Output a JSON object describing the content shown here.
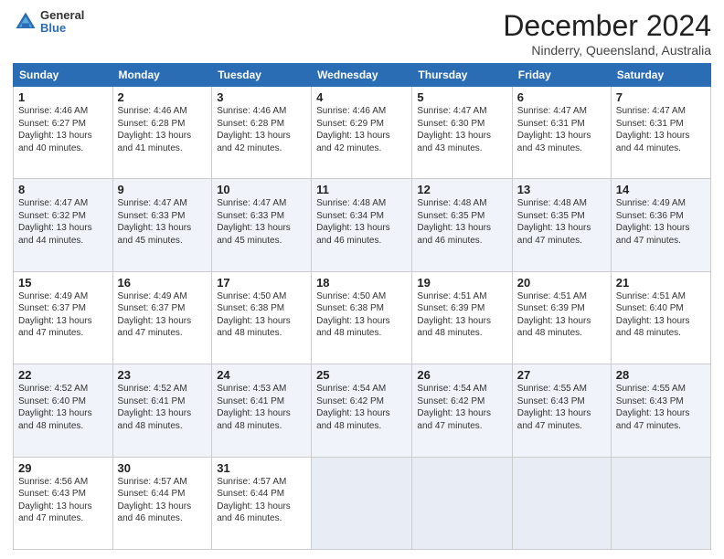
{
  "logo": {
    "general": "General",
    "blue": "Blue"
  },
  "header": {
    "month": "December 2024",
    "location": "Ninderry, Queensland, Australia"
  },
  "columns": [
    "Sunday",
    "Monday",
    "Tuesday",
    "Wednesday",
    "Thursday",
    "Friday",
    "Saturday"
  ],
  "weeks": [
    [
      {
        "day": "1",
        "info": "Sunrise: 4:46 AM\nSunset: 6:27 PM\nDaylight: 13 hours\nand 40 minutes."
      },
      {
        "day": "2",
        "info": "Sunrise: 4:46 AM\nSunset: 6:28 PM\nDaylight: 13 hours\nand 41 minutes."
      },
      {
        "day": "3",
        "info": "Sunrise: 4:46 AM\nSunset: 6:28 PM\nDaylight: 13 hours\nand 42 minutes."
      },
      {
        "day": "4",
        "info": "Sunrise: 4:46 AM\nSunset: 6:29 PM\nDaylight: 13 hours\nand 42 minutes."
      },
      {
        "day": "5",
        "info": "Sunrise: 4:47 AM\nSunset: 6:30 PM\nDaylight: 13 hours\nand 43 minutes."
      },
      {
        "day": "6",
        "info": "Sunrise: 4:47 AM\nSunset: 6:31 PM\nDaylight: 13 hours\nand 43 minutes."
      },
      {
        "day": "7",
        "info": "Sunrise: 4:47 AM\nSunset: 6:31 PM\nDaylight: 13 hours\nand 44 minutes."
      }
    ],
    [
      {
        "day": "8",
        "info": "Sunrise: 4:47 AM\nSunset: 6:32 PM\nDaylight: 13 hours\nand 44 minutes."
      },
      {
        "day": "9",
        "info": "Sunrise: 4:47 AM\nSunset: 6:33 PM\nDaylight: 13 hours\nand 45 minutes."
      },
      {
        "day": "10",
        "info": "Sunrise: 4:47 AM\nSunset: 6:33 PM\nDaylight: 13 hours\nand 45 minutes."
      },
      {
        "day": "11",
        "info": "Sunrise: 4:48 AM\nSunset: 6:34 PM\nDaylight: 13 hours\nand 46 minutes."
      },
      {
        "day": "12",
        "info": "Sunrise: 4:48 AM\nSunset: 6:35 PM\nDaylight: 13 hours\nand 46 minutes."
      },
      {
        "day": "13",
        "info": "Sunrise: 4:48 AM\nSunset: 6:35 PM\nDaylight: 13 hours\nand 47 minutes."
      },
      {
        "day": "14",
        "info": "Sunrise: 4:49 AM\nSunset: 6:36 PM\nDaylight: 13 hours\nand 47 minutes."
      }
    ],
    [
      {
        "day": "15",
        "info": "Sunrise: 4:49 AM\nSunset: 6:37 PM\nDaylight: 13 hours\nand 47 minutes."
      },
      {
        "day": "16",
        "info": "Sunrise: 4:49 AM\nSunset: 6:37 PM\nDaylight: 13 hours\nand 47 minutes."
      },
      {
        "day": "17",
        "info": "Sunrise: 4:50 AM\nSunset: 6:38 PM\nDaylight: 13 hours\nand 48 minutes."
      },
      {
        "day": "18",
        "info": "Sunrise: 4:50 AM\nSunset: 6:38 PM\nDaylight: 13 hours\nand 48 minutes."
      },
      {
        "day": "19",
        "info": "Sunrise: 4:51 AM\nSunset: 6:39 PM\nDaylight: 13 hours\nand 48 minutes."
      },
      {
        "day": "20",
        "info": "Sunrise: 4:51 AM\nSunset: 6:39 PM\nDaylight: 13 hours\nand 48 minutes."
      },
      {
        "day": "21",
        "info": "Sunrise: 4:51 AM\nSunset: 6:40 PM\nDaylight: 13 hours\nand 48 minutes."
      }
    ],
    [
      {
        "day": "22",
        "info": "Sunrise: 4:52 AM\nSunset: 6:40 PM\nDaylight: 13 hours\nand 48 minutes."
      },
      {
        "day": "23",
        "info": "Sunrise: 4:52 AM\nSunset: 6:41 PM\nDaylight: 13 hours\nand 48 minutes."
      },
      {
        "day": "24",
        "info": "Sunrise: 4:53 AM\nSunset: 6:41 PM\nDaylight: 13 hours\nand 48 minutes."
      },
      {
        "day": "25",
        "info": "Sunrise: 4:54 AM\nSunset: 6:42 PM\nDaylight: 13 hours\nand 48 minutes."
      },
      {
        "day": "26",
        "info": "Sunrise: 4:54 AM\nSunset: 6:42 PM\nDaylight: 13 hours\nand 47 minutes."
      },
      {
        "day": "27",
        "info": "Sunrise: 4:55 AM\nSunset: 6:43 PM\nDaylight: 13 hours\nand 47 minutes."
      },
      {
        "day": "28",
        "info": "Sunrise: 4:55 AM\nSunset: 6:43 PM\nDaylight: 13 hours\nand 47 minutes."
      }
    ],
    [
      {
        "day": "29",
        "info": "Sunrise: 4:56 AM\nSunset: 6:43 PM\nDaylight: 13 hours\nand 47 minutes."
      },
      {
        "day": "30",
        "info": "Sunrise: 4:57 AM\nSunset: 6:44 PM\nDaylight: 13 hours\nand 46 minutes."
      },
      {
        "day": "31",
        "info": "Sunrise: 4:57 AM\nSunset: 6:44 PM\nDaylight: 13 hours\nand 46 minutes."
      },
      null,
      null,
      null,
      null
    ]
  ]
}
